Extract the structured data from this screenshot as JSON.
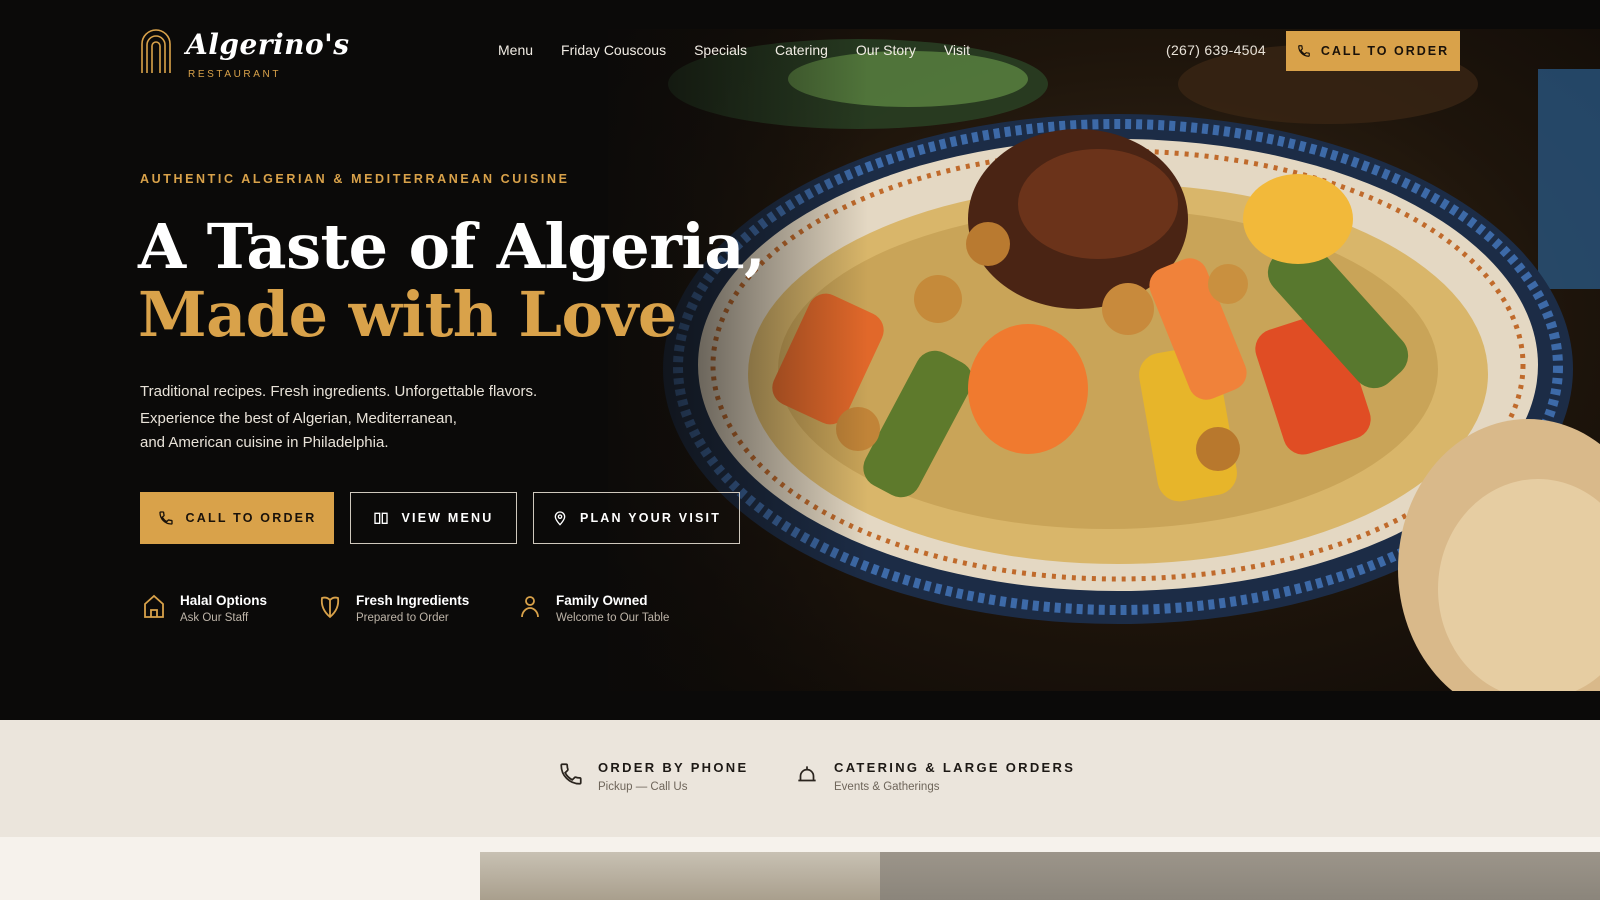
{
  "brand": {
    "name": "Algerino's",
    "sub": "RESTAURANT",
    "accent": "#d9a24a",
    "dark": "#0b0a09"
  },
  "nav": {
    "items": [
      "Menu",
      "Friday Couscous",
      "Specials",
      "Catering",
      "Our Story",
      "Visit"
    ],
    "phone": "(267) 639-4504",
    "cta_label": "CALL TO ORDER"
  },
  "hero": {
    "eyebrow": "AUTHENTIC ALGERIAN & MEDITERRANEAN CUISINE",
    "title_line1": "A Taste of Algeria,",
    "title_line2": "Made with Love",
    "desc_line1": "Traditional recipes. Fresh ingredients. Unforgettable flavors.",
    "desc_line2": "Experience the best of Algerian, Mediterranean,",
    "desc_line3": "and American cuisine in Philadelphia.",
    "buttons": {
      "call": "CALL TO ORDER",
      "menu": "VIEW MENU",
      "visit": "PLAN YOUR VISIT"
    },
    "features": [
      {
        "title": "Halal Options",
        "sub": "Ask Our Staff",
        "icon": "home-icon"
      },
      {
        "title": "Fresh Ingredients",
        "sub": "Prepared to Order",
        "icon": "leaf-icon"
      },
      {
        "title": "Family Owned",
        "sub": "Welcome to Our Table",
        "icon": "person-icon"
      }
    ]
  },
  "strip": {
    "items": [
      {
        "title": "ORDER BY PHONE",
        "sub": "Pickup — Call Us",
        "icon": "phone-icon"
      },
      {
        "title": "CATERING & LARGE ORDERS",
        "sub": "Events & Gatherings",
        "icon": "bell-icon"
      }
    ]
  }
}
